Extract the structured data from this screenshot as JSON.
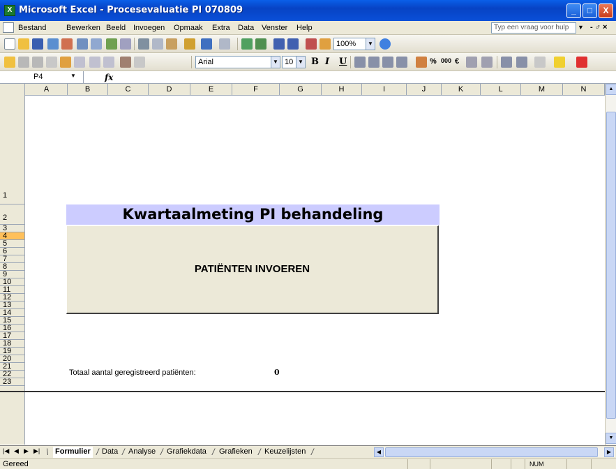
{
  "window": {
    "title": "Microsoft Excel - Procesevaluatie PI 070809",
    "buttons": [
      "_",
      "□",
      "X"
    ]
  },
  "menu": {
    "items": [
      "Bestand",
      "Bewerken",
      "Beeld",
      "Invoegen",
      "Opmaak",
      "Extra",
      "Data",
      "Venster",
      "Help"
    ],
    "help_placeholder": "Typ een vraag voor hulp",
    "doc_buttons": "- ♂ ×"
  },
  "toolbar": {
    "zoom": "100%",
    "font": "Arial",
    "font_size": "10",
    "bold": "B",
    "italic": "I",
    "underline": "U",
    "percent": "%",
    "thousands": "000",
    "euro": "€"
  },
  "formula_bar": {
    "name_box": "P4",
    "fx": "fx"
  },
  "columns": [
    "A",
    "B",
    "C",
    "D",
    "E",
    "F",
    "G",
    "H",
    "I",
    "J",
    "K",
    "L",
    "M",
    "N"
  ],
  "rows": [
    "1",
    "2",
    "3",
    "4",
    "5",
    "6",
    "7",
    "8",
    "9",
    "10",
    "11",
    "12",
    "13",
    "14",
    "15",
    "16",
    "17",
    "18",
    "19",
    "20",
    "21",
    "22",
    "23"
  ],
  "active_row": "4",
  "sheet": {
    "banner_title": "Kwartaalmeting PI behandeling",
    "button_label": "PATIËNTEN INVOEREN",
    "total_label": "Totaal aantal geregistreerd patiënten:",
    "total_value": "0"
  },
  "tabs": [
    "Formulier",
    "Data",
    "Analyse",
    "Grafiekdata",
    "Grafieken",
    "Keuzelijsten"
  ],
  "active_tab": "Formulier",
  "status": {
    "ready": "Gereed",
    "num": "NUM"
  }
}
